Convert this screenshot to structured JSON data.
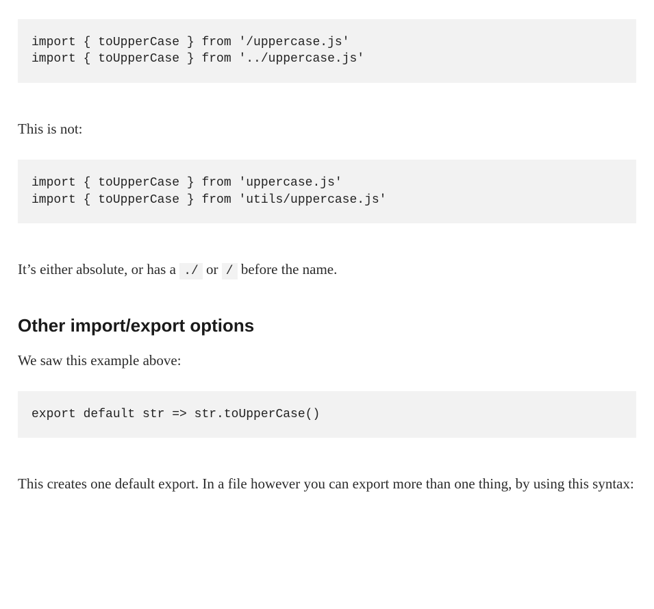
{
  "blocks": {
    "code1": "import { toUpperCase } from '/uppercase.js'\nimport { toUpperCase } from '../uppercase.js'",
    "text1": "This is not:",
    "code2": "import { toUpperCase } from 'uppercase.js'\nimport { toUpperCase } from 'utils/uppercase.js'",
    "text2_pre": "It’s either absolute, or has a ",
    "text2_code1": "./",
    "text2_mid": " or ",
    "text2_code2": "/",
    "text2_post": " before the name.",
    "heading1": "Other import/export options",
    "text3": "We saw this example above:",
    "code3": "export default str => str.toUpperCase()",
    "text4": "This creates one default export. In a file however you can export more than one thing, by using this syntax:"
  }
}
